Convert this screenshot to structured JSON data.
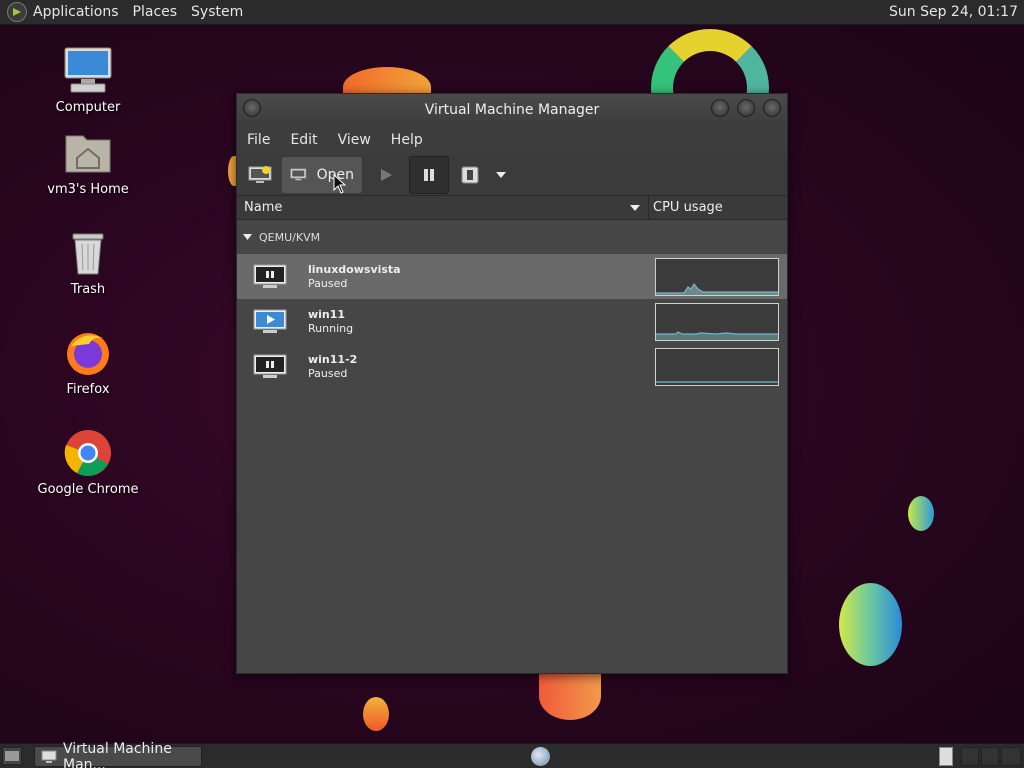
{
  "top_panel": {
    "menus": [
      "Applications",
      "Places",
      "System"
    ],
    "clock": "Sun Sep 24, 01:17"
  },
  "desktop": {
    "icons": [
      {
        "label": "Computer",
        "icon": "computer-icon"
      },
      {
        "label": "vm3's Home",
        "icon": "home-folder-icon"
      },
      {
        "label": "Trash",
        "icon": "trash-icon"
      },
      {
        "label": "Firefox",
        "icon": "firefox-icon"
      },
      {
        "label": "Google Chrome",
        "icon": "chrome-icon"
      }
    ]
  },
  "window": {
    "title": "Virtual Machine Manager",
    "menus": [
      "File",
      "Edit",
      "View",
      "Help"
    ],
    "toolbar": {
      "open_label": "Open"
    },
    "columns": {
      "name": "Name",
      "cpu": "CPU usage"
    },
    "group": "QEMU/KVM",
    "vms": [
      {
        "name": "linuxdowsvista",
        "status": "Paused",
        "state_icon": "pause-icon",
        "selected": true
      },
      {
        "name": "win11",
        "status": "Running",
        "state_icon": "play-icon",
        "selected": false
      },
      {
        "name": "win11-2",
        "status": "Paused",
        "state_icon": "pause-icon",
        "selected": false
      }
    ]
  },
  "bottom_panel": {
    "task_label": "Virtual Machine Man..."
  },
  "colors": {
    "panel_bg": "#2b2b2b",
    "window_bg": "#464646",
    "selected_row": "#6a6a6a",
    "graph_line": "#6aa6c8"
  }
}
